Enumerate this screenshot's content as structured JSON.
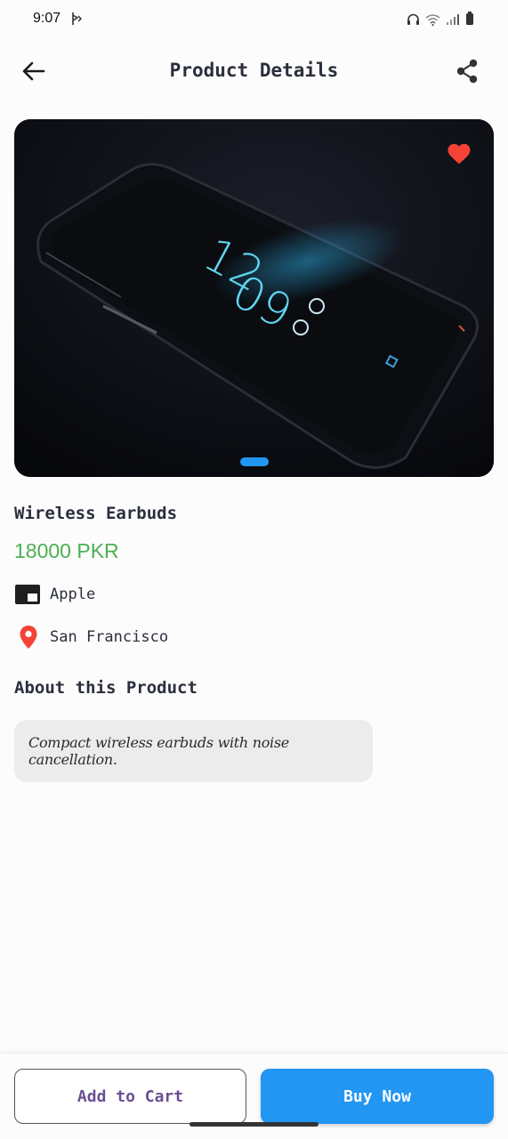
{
  "status_bar": {
    "time": "9:07",
    "icons": [
      "notification-icon",
      "headphones-icon",
      "wifi-icon",
      "signal-icon",
      "battery-icon"
    ]
  },
  "app_bar": {
    "title": "Product Details",
    "back_icon": "arrow-left-icon",
    "share_icon": "share-icon"
  },
  "hero": {
    "favorite_icon": "heart-icon",
    "favorite_color": "#f44336",
    "carousel_pages": 1,
    "active_page": 1,
    "indicator_color": "#2196f3"
  },
  "product": {
    "name": "Wireless Earbuds",
    "price": "18000 PKR",
    "brand": "Apple",
    "location": "San Francisco",
    "price_color": "#4caf50",
    "location_icon_color": "#f44336"
  },
  "about": {
    "heading": "About this Product",
    "description": "Compact wireless earbuds with noise cancellation."
  },
  "actions": {
    "add_to_cart": "Add to Cart",
    "buy_now": "Buy Now",
    "accent": "#2196f3"
  }
}
